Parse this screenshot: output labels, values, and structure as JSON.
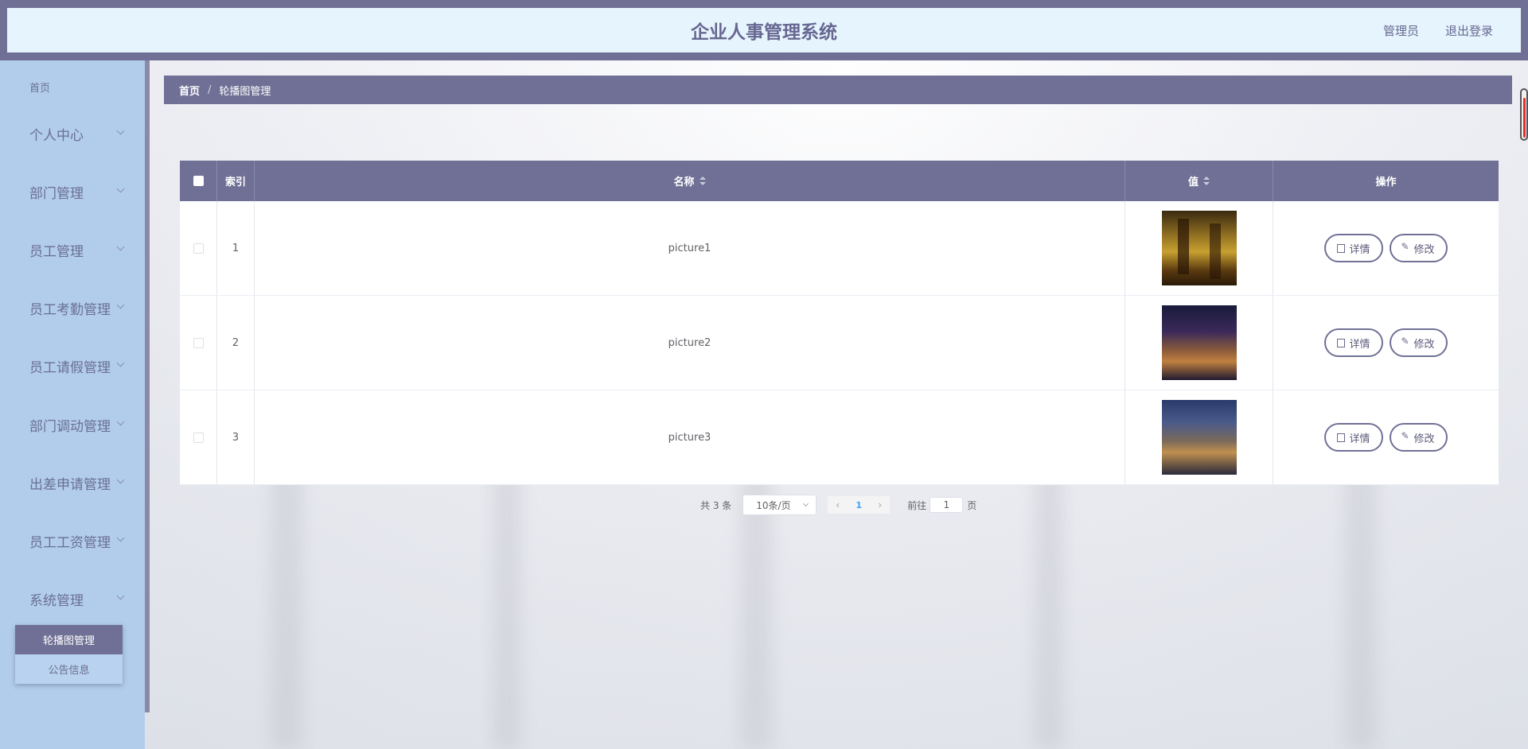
{
  "header": {
    "title": "企业人事管理系统",
    "user_label": "管理员",
    "logout_label": "退出登录"
  },
  "sidebar": {
    "home_label": "首页",
    "menu": [
      {
        "label": "个人中心",
        "icon": "chevron-down-icon"
      },
      {
        "label": "部门管理",
        "icon": "chevron-down-icon"
      },
      {
        "label": "员工管理",
        "icon": "chevron-down-icon"
      },
      {
        "label": "员工考勤管理",
        "icon": "chevron-down-icon"
      },
      {
        "label": "员工请假管理",
        "icon": "chevron-down-icon"
      },
      {
        "label": "部门调动管理",
        "icon": "chevron-down-icon"
      },
      {
        "label": "出差申请管理",
        "icon": "chevron-down-icon"
      },
      {
        "label": "员工工资管理",
        "icon": "chevron-down-icon"
      },
      {
        "label": "系统管理",
        "icon": "chevron-down-icon"
      }
    ],
    "submenu": [
      {
        "label": "轮播图管理",
        "active": true
      },
      {
        "label": "公告信息",
        "active": false
      }
    ]
  },
  "breadcrumb": {
    "items": [
      "首页",
      "轮播图管理"
    ],
    "separator": "/"
  },
  "table": {
    "columns": [
      "索引",
      "名称",
      "值",
      "操作"
    ],
    "rows": [
      {
        "index": "1",
        "name": "picture1",
        "value": "image-thumbnail"
      },
      {
        "index": "2",
        "name": "picture2",
        "value": "image-thumbnail"
      },
      {
        "index": "3",
        "name": "picture3",
        "value": "image-thumbnail"
      }
    ],
    "actions": {
      "detail_label": "详情",
      "edit_label": "修改"
    }
  },
  "pagination": {
    "total_text": "共 3 条",
    "page_size": "10条/页",
    "current_page": "1",
    "goto_label": "前往",
    "goto_value": "1",
    "page_suffix": "页"
  },
  "colors": {
    "primary": "#707096",
    "header_bg": "#e6f5fd",
    "sidebar_bg": "#b2cdec"
  }
}
